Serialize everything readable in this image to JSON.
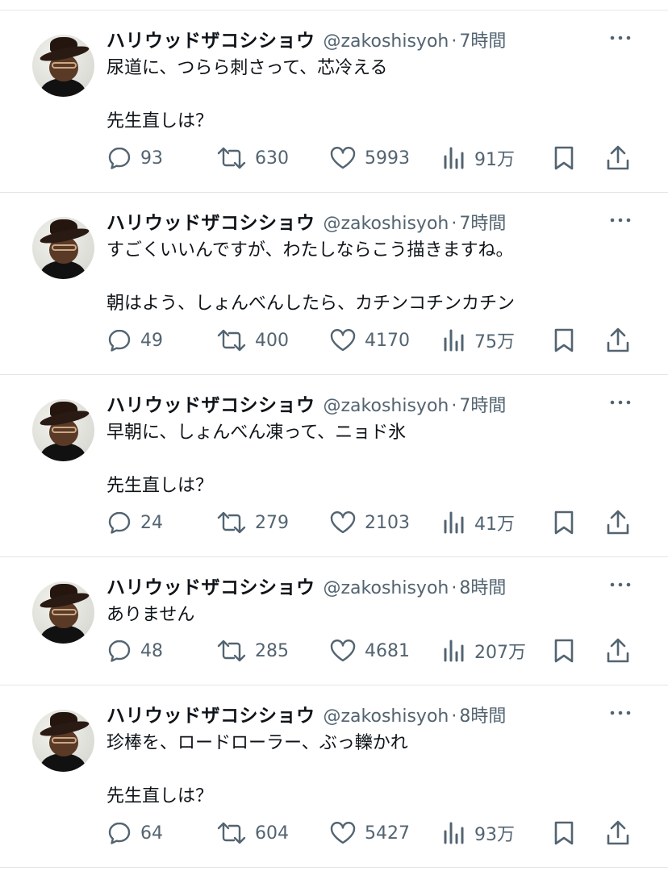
{
  "colors": {
    "text": "#0f1419",
    "secondary": "#536471",
    "divider": "#e1e4e8"
  },
  "tweets": [
    {
      "name": "ハリウッドザコシショウ",
      "handle": "@zakoshisyoh",
      "sep": "·",
      "time": "7時間",
      "text": "尿道に、つらら刺さって、芯冷える\n\n先生直しは？",
      "replies": "93",
      "retweets": "630",
      "likes": "5993",
      "views": "91万"
    },
    {
      "name": "ハリウッドザコシショウ",
      "handle": "@zakoshisyoh",
      "sep": "·",
      "time": "7時間",
      "text": "すごくいいんですが、わたしならこう描きますね。\n\n朝はよう、しょんべんしたら、カチンコチンカチン",
      "replies": "49",
      "retweets": "400",
      "likes": "4170",
      "views": "75万"
    },
    {
      "name": "ハリウッドザコシショウ",
      "handle": "@zakoshisyoh",
      "sep": "·",
      "time": "7時間",
      "text": "早朝に、しょんべん凍って、ニョド氷\n\n先生直しは？",
      "replies": "24",
      "retweets": "279",
      "likes": "2103",
      "views": "41万"
    },
    {
      "name": "ハリウッドザコシショウ",
      "handle": "@zakoshisyoh",
      "sep": "·",
      "time": "8時間",
      "text": "ありません",
      "replies": "48",
      "retweets": "285",
      "likes": "4681",
      "views": "207万"
    },
    {
      "name": "ハリウッドザコシショウ",
      "handle": "@zakoshisyoh",
      "sep": "·",
      "time": "8時間",
      "text": "珍棒を、ロードローラー、ぶっ轢かれ\n\n先生直しは？",
      "replies": "64",
      "retweets": "604",
      "likes": "5427",
      "views": "93万"
    }
  ]
}
